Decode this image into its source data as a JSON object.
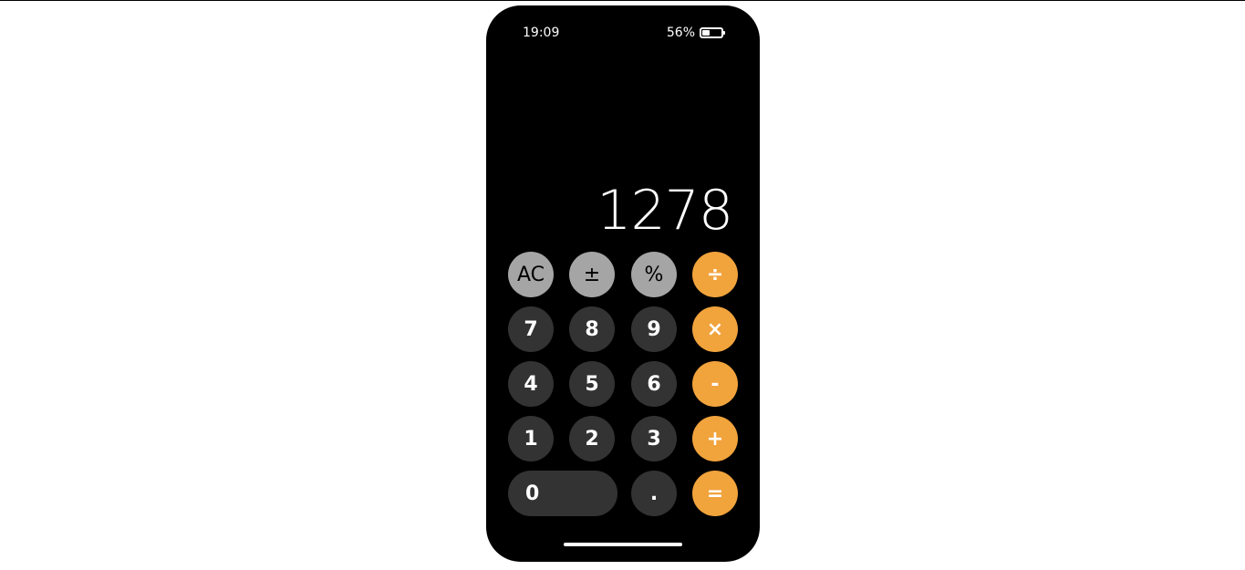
{
  "status": {
    "time": "19:09",
    "battery_percent": "56%",
    "battery_level": 0.56
  },
  "display": {
    "value": "1278"
  },
  "keys": {
    "ac": "AC",
    "plus_minus": "±",
    "percent": "%",
    "divide": "÷",
    "seven": "7",
    "eight": "8",
    "nine": "9",
    "multiply": "×",
    "four": "4",
    "five": "5",
    "six": "6",
    "minus": "-",
    "one": "1",
    "two": "2",
    "three": "3",
    "plus": "+",
    "zero": "0",
    "decimal": ".",
    "equals": "="
  },
  "colors": {
    "function_key": "#a5a5a5",
    "number_key": "#333333",
    "operator_key": "#f1a33c",
    "background": "#000000"
  }
}
